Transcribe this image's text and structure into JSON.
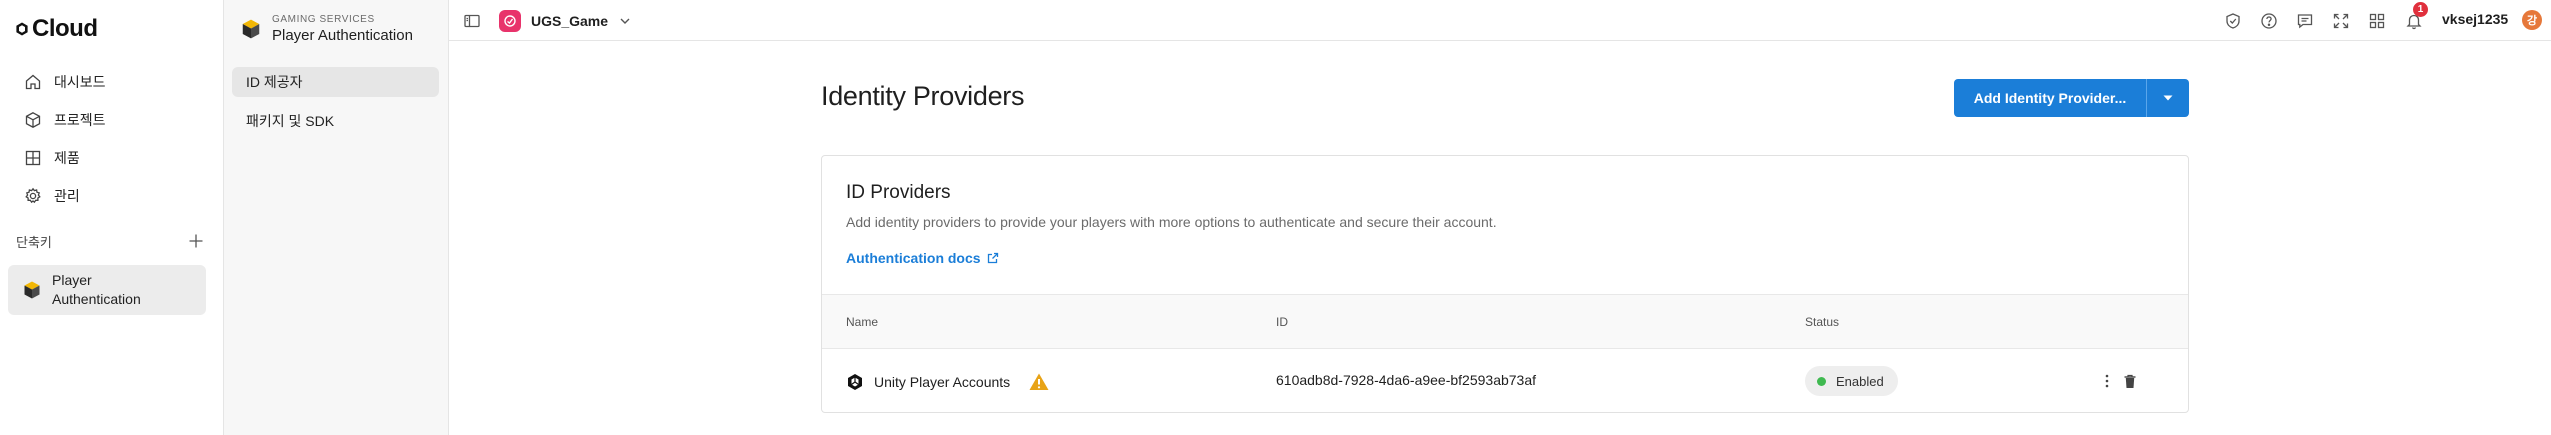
{
  "app": {
    "logo_text": "Cloud",
    "colors": {
      "accent": "#1b7ed8",
      "project_badge": "#e8336b",
      "status_enabled": "#3fb950",
      "notification": "#e0303d",
      "warning": "#e8a317"
    }
  },
  "leftnav": {
    "items": [
      {
        "label": "대시보드",
        "icon": "home-icon"
      },
      {
        "label": "프로젝트",
        "icon": "cube-icon"
      },
      {
        "label": "제품",
        "icon": "grid-icon"
      },
      {
        "label": "관리",
        "icon": "gear-icon"
      }
    ],
    "shortcuts_label": "단축키",
    "shortcut": {
      "label": "Player Authentication",
      "icon": "player-auth-icon"
    }
  },
  "service": {
    "kicker": "GAMING SERVICES",
    "title": "Player Authentication",
    "items": [
      {
        "label": "ID 제공자",
        "active": true
      },
      {
        "label": "패키지 및 SDK",
        "active": false
      }
    ]
  },
  "topbar": {
    "project_name": "UGS_Game",
    "notification_count": "1",
    "username": "vksej1235",
    "avatar_initial": "강",
    "icons": [
      "sidebar-toggle-icon",
      "shield-icon",
      "help-icon",
      "feedback-icon",
      "fullscreen-icon",
      "apps-icon",
      "bell-icon"
    ]
  },
  "main": {
    "title": "Identity Providers",
    "add_button_label": "Add Identity Provider...",
    "card": {
      "title": "ID Providers",
      "description": "Add identity providers to provide your players with more options to authenticate and secure their account.",
      "docs_link": "Authentication docs",
      "columns": {
        "name": "Name",
        "id": "ID",
        "status": "Status"
      },
      "rows": [
        {
          "name": "Unity Player Accounts",
          "id": "610adb8d-7928-4da6-a9ee-bf2593ab73af",
          "status": "Enabled"
        }
      ]
    }
  }
}
